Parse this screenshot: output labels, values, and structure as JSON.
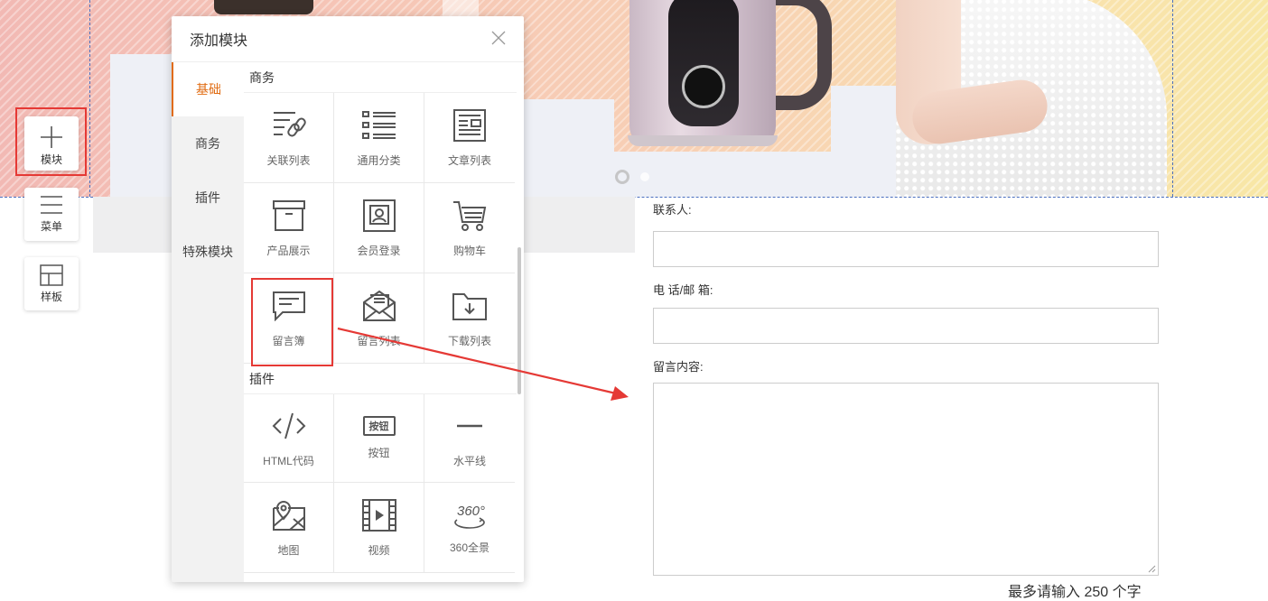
{
  "toolbar": {
    "items": [
      {
        "label": "模块",
        "icon": "plus-icon"
      },
      {
        "label": "菜单",
        "icon": "menu-lines-icon"
      },
      {
        "label": "样板",
        "icon": "template-icon"
      }
    ]
  },
  "dialog": {
    "title": "添加模块",
    "tabs": [
      "基础",
      "商务",
      "插件",
      "特殊模块"
    ],
    "active_tab": "基础",
    "sections": [
      {
        "title": "商务",
        "items": [
          {
            "label": "关联列表",
            "icon": "linked-list-icon"
          },
          {
            "label": "通用分类",
            "icon": "category-list-icon"
          },
          {
            "label": "文章列表",
            "icon": "article-list-icon"
          },
          {
            "label": "产品展示",
            "icon": "product-box-icon"
          },
          {
            "label": "会员登录",
            "icon": "member-login-icon"
          },
          {
            "label": "购物车",
            "icon": "shopping-cart-icon"
          },
          {
            "label": "留言簿",
            "icon": "guestbook-icon"
          },
          {
            "label": "留言列表",
            "icon": "message-list-icon"
          },
          {
            "label": "下载列表",
            "icon": "download-folder-icon"
          }
        ]
      },
      {
        "title": "插件",
        "items": [
          {
            "label": "HTML代码",
            "icon": "code-icon"
          },
          {
            "label": "按钮",
            "icon": "button-icon",
            "icon_text": "按钮"
          },
          {
            "label": "水平线",
            "icon": "horizontal-line-icon"
          },
          {
            "label": "地图",
            "icon": "map-icon"
          },
          {
            "label": "视频",
            "icon": "video-icon"
          },
          {
            "label": "360全景",
            "icon": "panorama-360-icon",
            "icon_text": "360°"
          }
        ]
      }
    ]
  },
  "form": {
    "contact_label": "联系人:",
    "phone_label": "电 话/邮 箱:",
    "message_label": "留言内容:",
    "hint": "最多请输入 250 个字"
  },
  "colors": {
    "accent": "#e06b12",
    "highlight": "#e53935"
  }
}
